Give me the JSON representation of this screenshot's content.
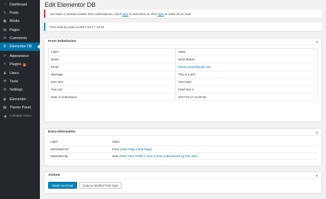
{
  "sidebar": {
    "items": [
      {
        "icon": "dashboard-icon",
        "glyph": "◔",
        "label": "Dashboard"
      },
      {
        "icon": "pin-icon",
        "glyph": "✎",
        "label": "Posts"
      },
      {
        "icon": "media-icon",
        "glyph": "▣",
        "label": "Media"
      },
      {
        "icon": "pages-icon",
        "glyph": "▤",
        "label": "Pages"
      },
      {
        "icon": "comments-icon",
        "glyph": "✉",
        "label": "Comments"
      },
      {
        "icon": "chat-icon",
        "glyph": "✆",
        "label": "Elementor DB"
      },
      {
        "icon": "brush-icon",
        "glyph": "✐",
        "label": "Appearance"
      },
      {
        "icon": "plugin-icon",
        "glyph": "⚡",
        "label": "Plugins",
        "badge": "1"
      },
      {
        "icon": "users-icon",
        "glyph": "♟",
        "label": "Users"
      },
      {
        "icon": "tools-icon",
        "glyph": "⚒",
        "label": "Tools"
      },
      {
        "icon": "settings-icon",
        "glyph": "⚙",
        "label": "Settings"
      },
      {
        "icon": "elementor-icon",
        "glyph": "◉",
        "label": "Elementor"
      },
      {
        "icon": "theme-panel-icon",
        "glyph": "▦",
        "label": "Theme Panel"
      },
      {
        "icon": "collapse-icon",
        "glyph": "◀",
        "label": "Collapse menu"
      }
    ]
  },
  "page": {
    "title": "Edit Elementor DB"
  },
  "notices": {
    "unread_pre": "You have 2 unread contact form submissions. Click ",
    "unread_link1": "here",
    "unread_mid": " to visit them or click ",
    "unread_link2": "here",
    "unread_post": " to mark all as read",
    "first_read": "First read by sean at 2017-04-17 13:40"
  },
  "form_submission": {
    "title": "Form Submission",
    "col_label": "Label",
    "col_value": "Value",
    "rows": [
      {
        "label": "Name",
        "value": "Sean Barton"
      },
      {
        "label": "Email",
        "value": "barton.sean@gmail.com"
      },
      {
        "label": "Message",
        "value": "This is a test"
      },
      {
        "label": "Item Test",
        "value": "Test Field"
      },
      {
        "label": "Test 123",
        "value": "Field Test 2"
      },
      {
        "label": "Date of Submission",
        "value": "2017-04-17 13:40:45"
      }
    ]
  },
  "extra_information": {
    "title": "Extra Information",
    "col_label": "Label",
    "col_value": "Value",
    "submitted_on_label": "Submitted On",
    "submitted_on_pre": "Form (",
    "view_page": "View Page",
    "sep": " | ",
    "edit_page": "Edit Page",
    "submitted_on_post": ")",
    "submitted_by_label": "Submitted By",
    "submitted_by_pre": "sean (",
    "view_user_profile": "View User Profile",
    "more_submissions": "View 3 more submissions by this user",
    "submitted_by_post": ")"
  },
  "actions": {
    "title": "Actions",
    "reply_label": "Reply via Email",
    "copy_label": "Copy to another Post Type"
  },
  "colors": {
    "sidebar_bg": "#23282d",
    "accent": "#0073aa",
    "error_border": "#dc3232",
    "info_border": "#00a0d2",
    "badge": "#d54e21"
  }
}
